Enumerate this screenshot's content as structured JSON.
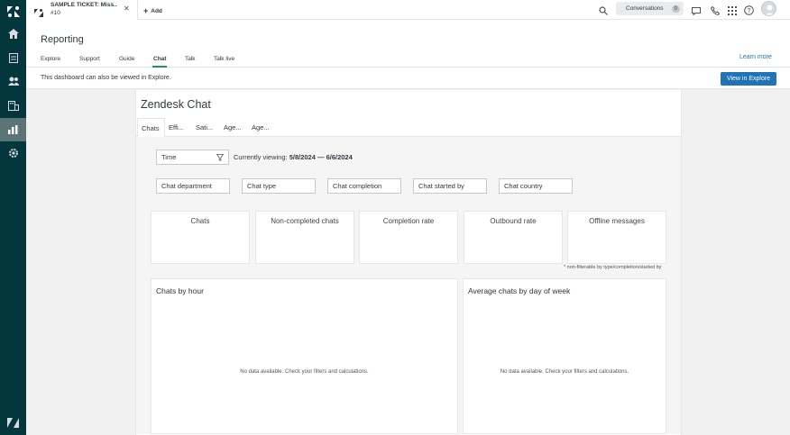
{
  "topbar": {
    "tab": {
      "title": "SAMPLE TICKET: Miss...",
      "subtitle": "#10"
    },
    "add_label": "Add",
    "conversations_label": "Conversations",
    "conversations_count": "0"
  },
  "header": {
    "title": "Reporting",
    "nav_tabs": [
      "Explore",
      "Support",
      "Guide",
      "Chat",
      "Talk",
      "Talk live"
    ],
    "active_tab": "Chat",
    "learn_more": "Learn more"
  },
  "banner": {
    "message": "This dashboard can also be viewed in Explore.",
    "button": "View in Explore"
  },
  "dashboard": {
    "title": "Zendesk Chat",
    "tabs": [
      "Chats",
      "Effi...",
      "Sati...",
      "Age...",
      "Age..."
    ],
    "time_filter": "Time",
    "viewing_prefix": "Currently viewing:",
    "viewing_range": "5/8/2024 — 6/6/2024",
    "filters": [
      "Chat department",
      "Chat type",
      "Chat completion",
      "Chat started by",
      "Chat country"
    ],
    "kpis": [
      "Chats",
      "Non-completed chats",
      "Completion rate",
      "Outbound rate",
      "Offline messages"
    ],
    "footnote": "* non-filterable by type/completion/started by",
    "charts": [
      {
        "title": "Chats by hour",
        "empty": "No data available. Check your filters and calculations."
      },
      {
        "title": "Average chats by day of week",
        "empty": "No data available. Check your filters and calculations."
      }
    ]
  },
  "colors": {
    "rail": "#03363d",
    "accent": "#228f67",
    "primary_button": "#1f73b7"
  }
}
